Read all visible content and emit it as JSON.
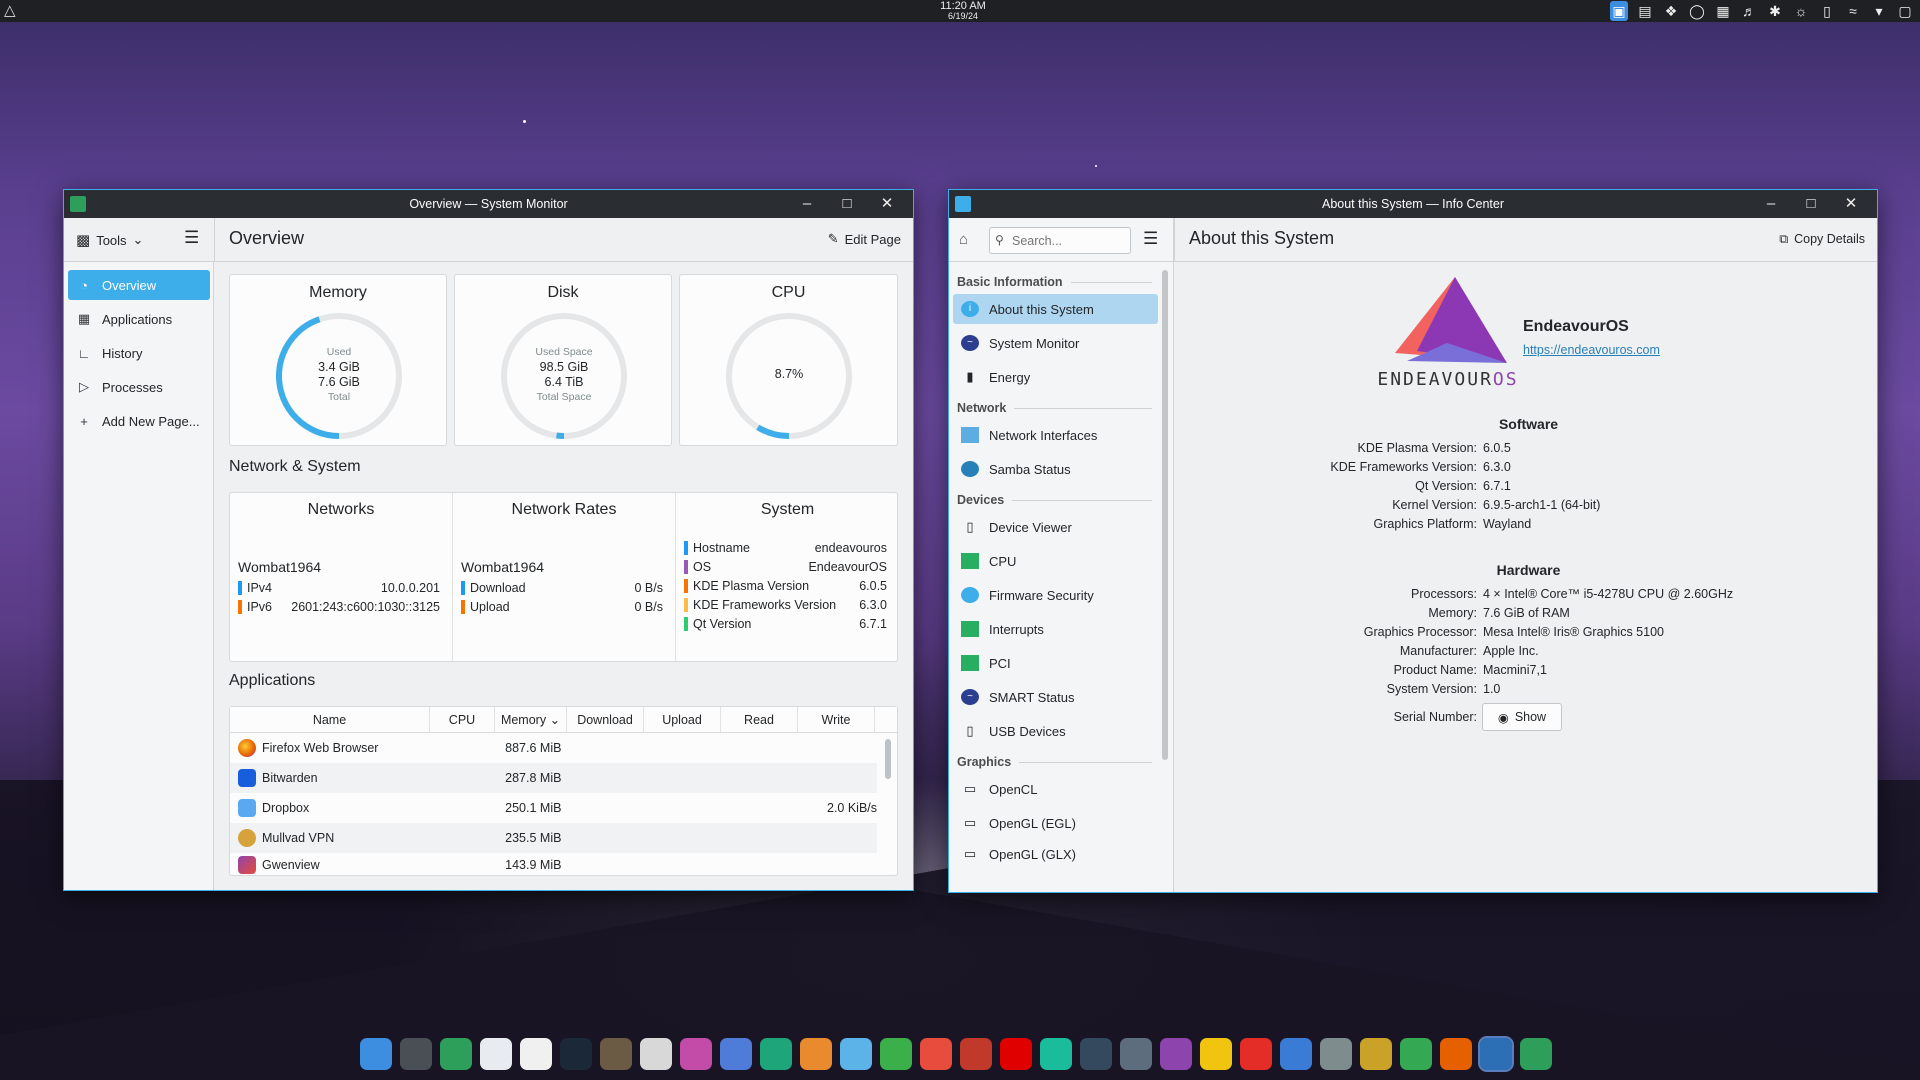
{
  "topbar": {
    "time": "11:20 AM",
    "date": "6/19/24",
    "tray_icons": [
      "bitwarden-icon",
      "window-icon",
      "dropbox-icon",
      "vpn-shield-icon",
      "clipboard-icon",
      "volume-icon",
      "bluetooth-icon",
      "brightness-icon",
      "battery-icon",
      "wifi-icon",
      "expand-arrow-icon",
      "desktop-icon"
    ]
  },
  "sysmon": {
    "window_title": "Overview — System Monitor",
    "tools_label": "Tools",
    "page_title": "Overview",
    "edit_page": "Edit Page",
    "nav": [
      {
        "label": "Overview",
        "icon": "speedometer-icon"
      },
      {
        "label": "Applications",
        "icon": "grid-icon"
      },
      {
        "label": "History",
        "icon": "chart-icon"
      },
      {
        "label": "Processes",
        "icon": "play-icon"
      },
      {
        "label": "Add New Page...",
        "icon": "plus-icon"
      }
    ],
    "memory": {
      "title": "Memory",
      "line1": "Used",
      "line2": "3.4 GiB",
      "line3": "7.6 GiB",
      "line4": "Total",
      "fraction": 0.447
    },
    "disk": {
      "title": "Disk",
      "line1": "Used Space",
      "line2": "98.5 GiB",
      "line3": "6.4 TiB",
      "line4": "Total Space",
      "fraction": 0.015
    },
    "cpu": {
      "title": "CPU",
      "value": "8.7%",
      "fraction": 0.087
    },
    "network_system_title": "Network & System",
    "networks": {
      "title": "Networks",
      "host": "Wombat1964",
      "rows": [
        {
          "key": "IPv4",
          "value": "10.0.0.201",
          "color": "#1d99f3"
        },
        {
          "key": "IPv6",
          "value": "2601:243:c600:1030::3125",
          "color": "#f67400"
        }
      ]
    },
    "rates": {
      "title": "Network Rates",
      "host": "Wombat1964",
      "rows": [
        {
          "key": "Download",
          "value": "0 B/s",
          "color": "#1d99f3"
        },
        {
          "key": "Upload",
          "value": "0 B/s",
          "color": "#f67400"
        }
      ]
    },
    "system": {
      "title": "System",
      "rows": [
        {
          "key": "Hostname",
          "value": "endeavouros",
          "color": "#1d99f3"
        },
        {
          "key": "OS",
          "value": "EndeavourOS",
          "color": "#9b59b6"
        },
        {
          "key": "KDE Plasma Version",
          "value": "6.0.5",
          "color": "#f67400"
        },
        {
          "key": "KDE Frameworks Version",
          "value": "6.3.0",
          "color": "#fdbc4b"
        },
        {
          "key": "Qt Version",
          "value": "6.7.1",
          "color": "#2ecc71"
        }
      ]
    },
    "applications_title": "Applications",
    "columns": [
      "Name",
      "CPU",
      "Memory",
      "Download",
      "Upload",
      "Read",
      "Write"
    ],
    "apps": [
      {
        "name": "Firefox Web Browser",
        "cpu": "",
        "memory": "887.6 MiB",
        "download": "",
        "upload": "",
        "read": "",
        "write": "",
        "icon": "firefox-icon",
        "color": "#e66000"
      },
      {
        "name": "Bitwarden",
        "cpu": "",
        "memory": "287.8 MiB",
        "download": "",
        "upload": "",
        "read": "",
        "write": "",
        "icon": "bitwarden-icon",
        "color": "#175ddc"
      },
      {
        "name": "Dropbox",
        "cpu": "",
        "memory": "250.1 MiB",
        "download": "",
        "upload": "",
        "read": "",
        "write": "2.0 KiB/s",
        "icon": "dropbox-icon",
        "color": "#0061fe"
      },
      {
        "name": "Mullvad VPN",
        "cpu": "",
        "memory": "235.5 MiB",
        "download": "",
        "upload": "",
        "read": "",
        "write": "",
        "icon": "mullvad-icon",
        "color": "#d6a23b"
      },
      {
        "name": "Gwenview",
        "cpu": "",
        "memory": "143.9 MiB",
        "download": "",
        "upload": "",
        "read": "",
        "write": "",
        "icon": "gwenview-icon",
        "color": "#8e44ad"
      }
    ]
  },
  "infocenter": {
    "window_title": "About this System — Info Center",
    "search_placeholder": "Search...",
    "page_title": "About this System",
    "copy_details": "Copy Details",
    "groups": [
      {
        "label": "Basic Information",
        "items": [
          {
            "label": "About this System",
            "icon": "info-icon",
            "active": true
          },
          {
            "label": "System Monitor",
            "icon": "monitor-wave-icon"
          },
          {
            "label": "Energy",
            "icon": "battery-icon"
          }
        ]
      },
      {
        "label": "Network",
        "items": [
          {
            "label": "Network Interfaces",
            "icon": "network-card-icon"
          },
          {
            "label": "Samba Status",
            "icon": "samba-icon"
          }
        ]
      },
      {
        "label": "Devices",
        "items": [
          {
            "label": "Device Viewer",
            "icon": "phone-icon"
          },
          {
            "label": "CPU",
            "icon": "chip-icon"
          },
          {
            "label": "Firmware Security",
            "icon": "shield-icon"
          },
          {
            "label": "Interrupts",
            "icon": "chip-icon"
          },
          {
            "label": "PCI",
            "icon": "chip-icon"
          },
          {
            "label": "SMART Status",
            "icon": "monitor-wave-icon"
          },
          {
            "label": "USB Devices",
            "icon": "phone-icon"
          }
        ]
      },
      {
        "label": "Graphics",
        "items": [
          {
            "label": "OpenCL",
            "icon": "display-icon"
          },
          {
            "label": "OpenGL (EGL)",
            "icon": "display-icon"
          },
          {
            "label": "OpenGL (GLX)",
            "icon": "display-icon"
          }
        ]
      }
    ],
    "logo_text_a": "ENDEAVOUR",
    "logo_text_b": "OS",
    "distro_name": "EndeavourOS",
    "distro_url": "https://endeavouros.com",
    "software_title": "Software",
    "software": [
      {
        "key": "KDE Plasma Version:",
        "value": "6.0.5"
      },
      {
        "key": "KDE Frameworks Version:",
        "value": "6.3.0"
      },
      {
        "key": "Qt Version:",
        "value": "6.7.1"
      },
      {
        "key": "Kernel Version:",
        "value": "6.9.5-arch1-1 (64-bit)"
      },
      {
        "key": "Graphics Platform:",
        "value": "Wayland"
      }
    ],
    "hardware_title": "Hardware",
    "hardware": [
      {
        "key": "Processors:",
        "value": "4 × Intel® Core™ i5-4278U CPU @ 2.60GHz"
      },
      {
        "key": "Memory:",
        "value": "7.6 GiB of RAM"
      },
      {
        "key": "Graphics Processor:",
        "value": "Mesa Intel® Iris® Graphics 5100"
      },
      {
        "key": "Manufacturer:",
        "value": "Apple Inc."
      },
      {
        "key": "Product Name:",
        "value": "Macmini7,1"
      },
      {
        "key": "System Version:",
        "value": "1.0"
      }
    ],
    "serial_label": "Serial Number:",
    "show_label": "Show"
  },
  "dock": [
    {
      "name": "files",
      "color": "#3d8ee0"
    },
    {
      "name": "terminal",
      "color": "#4a4f55"
    },
    {
      "name": "spreadsheet",
      "color": "#2e9e5b"
    },
    {
      "name": "document",
      "color": "#e8ecf0"
    },
    {
      "name": "text-editor",
      "color": "#f0f0f0"
    },
    {
      "name": "steam",
      "color": "#1b2838"
    },
    {
      "name": "gimp",
      "color": "#6b5b45"
    },
    {
      "name": "inkscape",
      "color": "#d8d8d8"
    },
    {
      "name": "krita",
      "color": "#c24ca8"
    },
    {
      "name": "blender-grid",
      "color": "#4f7bd9"
    },
    {
      "name": "headphones",
      "color": "#1fa57a"
    },
    {
      "name": "camera",
      "color": "#e98a2f"
    },
    {
      "name": "chromium",
      "color": "#5bb3e8"
    },
    {
      "name": "edge",
      "color": "#3bb04a"
    },
    {
      "name": "audio",
      "color": "#e74c3c"
    },
    {
      "name": "record",
      "color": "#c0392b"
    },
    {
      "name": "youtube-music",
      "color": "#e00000"
    },
    {
      "name": "music",
      "color": "#1abc9c"
    },
    {
      "name": "wolf",
      "color": "#34495e"
    },
    {
      "name": "screen",
      "color": "#5d6d7e"
    },
    {
      "name": "video",
      "color": "#8e44ad"
    },
    {
      "name": "folder",
      "color": "#f1c40f"
    },
    {
      "name": "youtube",
      "color": "#e52d27"
    },
    {
      "name": "qbittorrent",
      "color": "#3a7bd5"
    },
    {
      "name": "screenshot",
      "color": "#7f8c8d"
    },
    {
      "name": "tools",
      "color": "#c9a227"
    },
    {
      "name": "chrome",
      "color": "#34a853"
    },
    {
      "name": "firefox",
      "color": "#e66000"
    },
    {
      "name": "system-monitor",
      "color": "#2c6fb5"
    },
    {
      "name": "info-center",
      "color": "#2e9e5b"
    }
  ]
}
